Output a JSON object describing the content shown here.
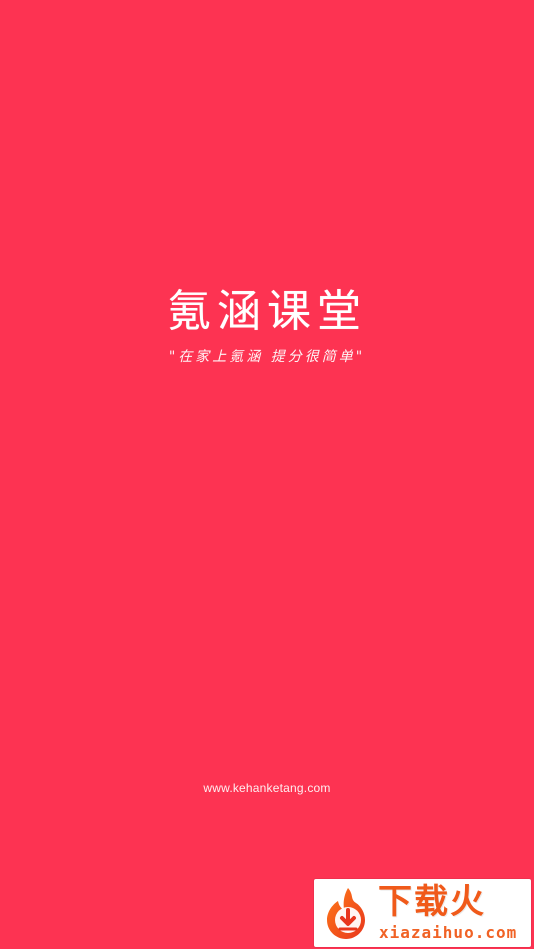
{
  "colors": {
    "background": "#fd3352",
    "foreground": "#ffffff",
    "watermark_accent": "#f05a1a"
  },
  "brand": {
    "title": "氪涵课堂",
    "tagline": "\"在家上氪涵 提分很简单\""
  },
  "footer": {
    "website": "www.kehanketang.com"
  },
  "watermark": {
    "logo_icon": "flame-download-icon",
    "title": "下载火",
    "domain": "xiazaihuo.com"
  }
}
